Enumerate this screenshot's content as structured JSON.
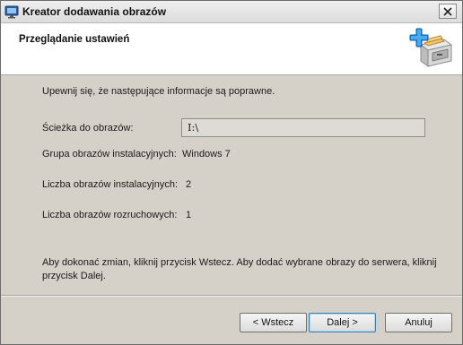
{
  "window": {
    "title": "Kreator dodawania obrazów",
    "close_label": "✕"
  },
  "header": {
    "title": "Przeglądanie ustawień"
  },
  "content": {
    "intro": "Upewnij się, że następujące informacje są poprawne.",
    "fields": [
      {
        "label": "Ścieżka do obrazów:",
        "value": "I:\\"
      },
      {
        "label": "Grupa obrazów instalacyjnych:",
        "value": "Windows 7"
      },
      {
        "label": "Liczba obrazów instalacyjnych:",
        "value": "2"
      },
      {
        "label": "Liczba obrazów rozruchowych:",
        "value": "1"
      }
    ],
    "info": "Aby dokonać zmian, kliknij przycisk Wstecz. Aby dodać wybrane obrazy do serwera, kliknij przycisk Dalej."
  },
  "buttons": {
    "back": "< Wstecz",
    "next": "Dalej >",
    "cancel": "Anuluj"
  },
  "icons": {
    "app": "monitor-icon",
    "header": "add-to-cabinet-icon",
    "close": "close-icon"
  }
}
